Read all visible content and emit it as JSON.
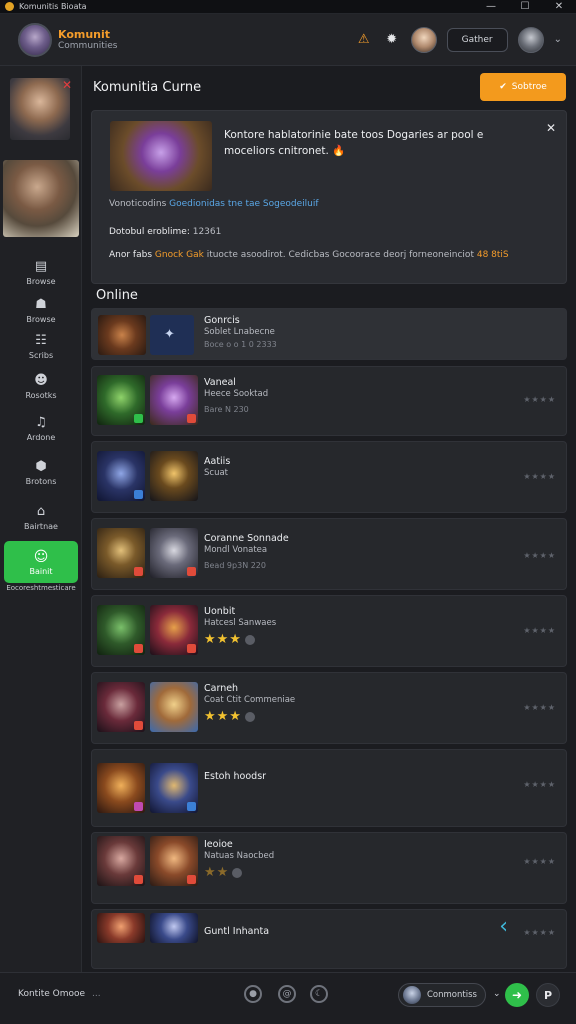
{
  "window": {
    "title": "Komunitis Bioata",
    "controls": [
      "—",
      "☐",
      "✕"
    ]
  },
  "header": {
    "brand_line1": "Komunit",
    "brand_line2": "Communities",
    "button_label": "Gather",
    "icons": {
      "warn": "warning-icon",
      "gear": "gear-icon"
    }
  },
  "sidebar": {
    "items": [
      {
        "label": "Browse",
        "icon": "inbox-icon",
        "glyph": "▤"
      },
      {
        "label": "Browse",
        "icon": "people-icon",
        "glyph": "☗"
      },
      {
        "label": "Scribs",
        "icon": "chat-icon",
        "glyph": "☷"
      },
      {
        "label": "Rosotks",
        "icon": "user-icon",
        "glyph": "☻"
      },
      {
        "label": "Ardone",
        "icon": "mic-icon",
        "glyph": "♫"
      },
      {
        "label": "Brotons",
        "icon": "shield-icon",
        "glyph": "⬢"
      },
      {
        "label": "Bairtnae",
        "icon": "home-icon",
        "glyph": "⌂"
      }
    ],
    "active": {
      "label": "Bainit",
      "glyph": "☺"
    },
    "sub_label": "Eocoreshtmesticare"
  },
  "main": {
    "title": "Komunitia Curne",
    "primary_button": "Sobtroe",
    "banner": {
      "text": "Kontore hablatorinie bate toos Dogaries ar pool e moceliors cnitronet.",
      "fire": "🔥",
      "line1_prefix": "Vonoticodins",
      "line1_link": "Goedionidas tne tae Sogeodeiluif",
      "line2_label": "Dotobul eroblime:",
      "line2_value": "12361",
      "line3_prefix": "Anor fabs",
      "line3_highlight": "Gnock Gak",
      "line3_mid": "ituocte asoodirot. Cedicbas Gocoorace deorj forneoneinciot",
      "line3_value": "48 8tiS"
    },
    "online_title": "Online",
    "rows": [
      {
        "name": "Gonrcis",
        "sub": "Soblet Lnabecne",
        "meta": "Boce o o 1 0 2333",
        "stars": "",
        "rating": ""
      },
      {
        "name": "Vaneal",
        "sub": "Heece Sooktad",
        "meta": "Bare N 230",
        "stars": "",
        "rating": "★★★★"
      },
      {
        "name": "Aatiis",
        "sub": "Scuat",
        "meta": "",
        "stars": "",
        "rating": "★★★★"
      },
      {
        "name": "Coranne Sonnade",
        "sub": "Mondl Vonatea",
        "meta": "Bead 9p3N 220",
        "stars": "",
        "rating": "★★★★"
      },
      {
        "name": "Uonbit",
        "sub": "Hatcesl Sanwaes",
        "meta": "",
        "stars": "★★★",
        "rating": "★★★★"
      },
      {
        "name": "Carneh",
        "sub": "Coat Ctit Commeniae",
        "meta": "",
        "stars": "★★★",
        "rating": "★★★★"
      },
      {
        "name": "Estoh hoodsr",
        "sub": "",
        "meta": "",
        "stars": "",
        "rating": "★★★★"
      },
      {
        "name": "Ieoioe",
        "sub": "Natuas Naocbed",
        "meta": "",
        "stars": "★★",
        "rating": "★★★★"
      },
      {
        "name": "Guntl Inhanta",
        "sub": "",
        "meta": "",
        "stars": "",
        "rating": "★★★★"
      }
    ]
  },
  "footer": {
    "title": "Kontite Omooe",
    "dots": "...",
    "pill_label": "Conmontiss",
    "chevron": "⌄",
    "p_label": "P"
  },
  "colors": {
    "accent_orange": "#f39a1d",
    "accent_green": "#2fbf4a",
    "bg": "#1b1c20"
  }
}
